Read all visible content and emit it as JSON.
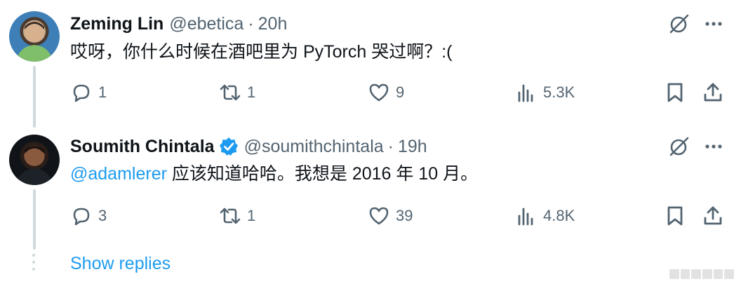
{
  "tweets": [
    {
      "name": "Zeming Lin",
      "handle": "@ebetica",
      "separator": "·",
      "time": "20h",
      "text": "哎呀，你什么时候在酒吧里为 PyTorch 哭过啊？:(",
      "mention": "",
      "verified": false,
      "replies": "1",
      "retweets": "1",
      "likes": "9",
      "views": "5.3K"
    },
    {
      "name": "Soumith Chintala",
      "handle": "@soumithchintala",
      "separator": "·",
      "time": "19h",
      "mention": "@adamlerer",
      "text": " 应该知道哈哈。我想是 2016 年 10 月。",
      "verified": true,
      "replies": "3",
      "retweets": "1",
      "likes": "39",
      "views": "4.8K"
    }
  ],
  "show_replies_label": "Show replies",
  "colors": {
    "text": "#0f1419",
    "secondary": "#536471",
    "accent": "#1d9bf0",
    "line": "#cfd9de"
  },
  "icons": [
    "grok-icon",
    "more-icon",
    "reply-icon",
    "retweet-icon",
    "like-icon",
    "views-icon",
    "bookmark-icon",
    "share-icon",
    "verified-badge-icon"
  ]
}
